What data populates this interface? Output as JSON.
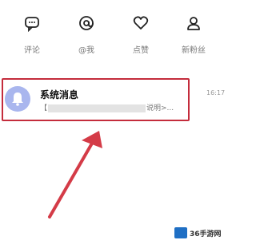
{
  "quick_actions": [
    {
      "label": "评论",
      "icon": "comment-icon"
    },
    {
      "label": "@我",
      "icon": "at-icon"
    },
    {
      "label": "点赞",
      "icon": "heart-icon"
    },
    {
      "label": "新粉丝",
      "icon": "person-icon"
    }
  ],
  "message": {
    "title": "系统消息",
    "preview_prefix": "【",
    "preview_suffix": "说明>...",
    "time": "16:17",
    "avatar_icon": "bell-icon"
  },
  "watermark": {
    "text": "36手游网",
    "logo_icon": "site-logo-icon"
  },
  "colors": {
    "highlight": "#c42c3c",
    "avatar_bg": "#a9b6ee",
    "arrow": "#d43b47"
  }
}
